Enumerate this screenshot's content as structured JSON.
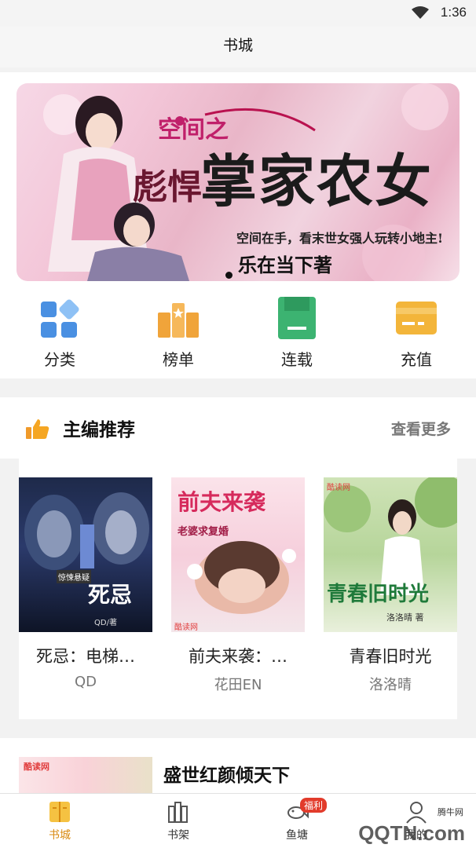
{
  "status_bar": {
    "time": "1:36"
  },
  "header": {
    "title": "书城"
  },
  "banner": {
    "subtitle": "空间之",
    "prefix": "彪悍",
    "main_title": "掌家农女",
    "tagline": "空间在手，看末世女强人玩转小地主!",
    "author": "乐在当下著"
  },
  "categories": [
    {
      "label": "分类",
      "icon": "category-icon",
      "color": "#4a90e2"
    },
    {
      "label": "榜单",
      "icon": "ranking-icon",
      "color": "#f0a43a"
    },
    {
      "label": "连载",
      "icon": "serial-book-icon",
      "color": "#3cb371"
    },
    {
      "label": "充值",
      "icon": "recharge-card-icon",
      "color": "#f3b53a"
    }
  ],
  "section": {
    "title": "主编推荐",
    "more": "查看更多"
  },
  "books": [
    {
      "name": "死忌：电梯…",
      "author": "QD",
      "cover_title": "死忌",
      "cover_sub": "惊悚悬疑",
      "cover_author": "QD/著"
    },
    {
      "name": "前夫来袭：…",
      "author": "花田EN",
      "cover_title": "前夫来袭",
      "cover_sub": "老婆求复婚",
      "cover_logo": "酷读网"
    },
    {
      "name": "青春旧时光",
      "author": "洛洛晴",
      "cover_title": "青春旧时光",
      "cover_sub": "洛洛晴 著",
      "cover_logo": "酷读网"
    }
  ],
  "next_book": {
    "name": "盛世红颜倾天下",
    "logo": "酷读网"
  },
  "tabs": [
    {
      "label": "书城",
      "icon": "bookstore-icon",
      "active": true
    },
    {
      "label": "书架",
      "icon": "bookshelf-icon",
      "active": false
    },
    {
      "label": "鱼塘",
      "icon": "fish-icon",
      "active": false,
      "badge": "福利"
    },
    {
      "label": "我的",
      "icon": "profile-icon",
      "active": false
    }
  ],
  "watermark": {
    "text": "QQTN.com",
    "small": "腾牛网"
  },
  "colors": {
    "accent": "#d88a10",
    "badge": "#e23b2b"
  }
}
